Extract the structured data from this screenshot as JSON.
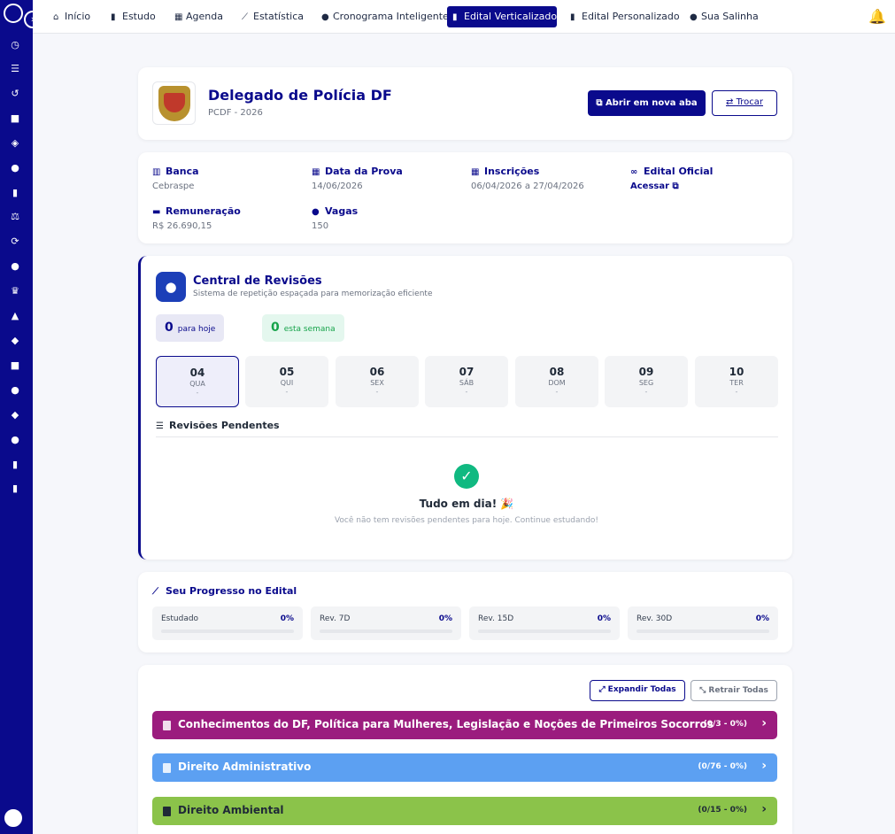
{
  "nav": {
    "items": [
      {
        "label": "Início",
        "icon": "home-icon"
      },
      {
        "label": "Estudo",
        "icon": "book-icon"
      },
      {
        "label": "Agenda",
        "icon": "calendar-icon"
      },
      {
        "label": "Estatística",
        "icon": "chart-icon"
      },
      {
        "label": "Cronograma Inteligente",
        "icon": "brain-icon"
      },
      {
        "label": "Edital Verticalizado",
        "icon": "document-icon"
      },
      {
        "label": "Edital Personalizado",
        "icon": "document-icon"
      },
      {
        "label": "Sua Salinha",
        "icon": "users-icon"
      }
    ],
    "active": "Edital Verticalizado"
  },
  "header": {
    "title": "Delegado de Polícia DF",
    "subtitle": "PCDF - 2026",
    "open_new_tab": "Abrir em nova aba",
    "switch": "Trocar"
  },
  "info": {
    "banca": {
      "label": "Banca",
      "value": "Cebraspe"
    },
    "data_prova": {
      "label": "Data da Prova",
      "value": "14/06/2026"
    },
    "inscricoes": {
      "label": "Inscrições",
      "value": "06/04/2026 a 27/04/2026"
    },
    "edital": {
      "label": "Edital Oficial",
      "value": "Acessar"
    },
    "remuneracao": {
      "label": "Remuneração",
      "value": "R$ 26.690,15"
    },
    "vagas": {
      "label": "Vagas",
      "value": "150"
    }
  },
  "revisoes": {
    "title": "Central de Revisões",
    "subtitle": "Sistema de repetição espaçada para memorização eficiente",
    "today_count": "0",
    "today_label": "para hoje",
    "week_count": "0",
    "week_label": "esta semana",
    "days": [
      {
        "num": "04",
        "name": "QUA",
        "count": "-"
      },
      {
        "num": "05",
        "name": "QUI",
        "count": "-"
      },
      {
        "num": "06",
        "name": "SEX",
        "count": "-"
      },
      {
        "num": "07",
        "name": "SÁB",
        "count": "-"
      },
      {
        "num": "08",
        "name": "DOM",
        "count": "-"
      },
      {
        "num": "09",
        "name": "SEG",
        "count": "-"
      },
      {
        "num": "10",
        "name": "TER",
        "count": "-"
      }
    ],
    "pending_title": "Revisões Pendentes",
    "empty_title": "Tudo em dia! 🎉",
    "empty_sub": "Você não tem revisões pendentes para hoje. Continue estudando!"
  },
  "progresso": {
    "title": "Seu Progresso no Edital",
    "items": [
      {
        "label": "Estudado",
        "pct": "0%",
        "value": 0
      },
      {
        "label": "Rev. 7D",
        "pct": "0%",
        "value": 0
      },
      {
        "label": "Rev. 15D",
        "pct": "0%",
        "value": 0
      },
      {
        "label": "Rev. 30D",
        "pct": "0%",
        "value": 0
      }
    ]
  },
  "subjects": {
    "expand_all": "Expandir Todas",
    "collapse_all": "Retrair Todas",
    "items": [
      {
        "name": "Conhecimentos do DF, Política para Mulheres, Legislação e Noções de Primeiros Socorros",
        "count": "(0/3 - 0%)",
        "color": "#9b1c7e"
      },
      {
        "name": "Direito Administrativo",
        "count": "(0/76 - 0%)",
        "color": "#5ca0f2"
      },
      {
        "name": "Direito Ambiental",
        "count": "(0/15 - 0%)",
        "color": "#8bc34a"
      }
    ]
  },
  "colors": {
    "brand": "#0a0a8c",
    "success": "#10b981"
  }
}
